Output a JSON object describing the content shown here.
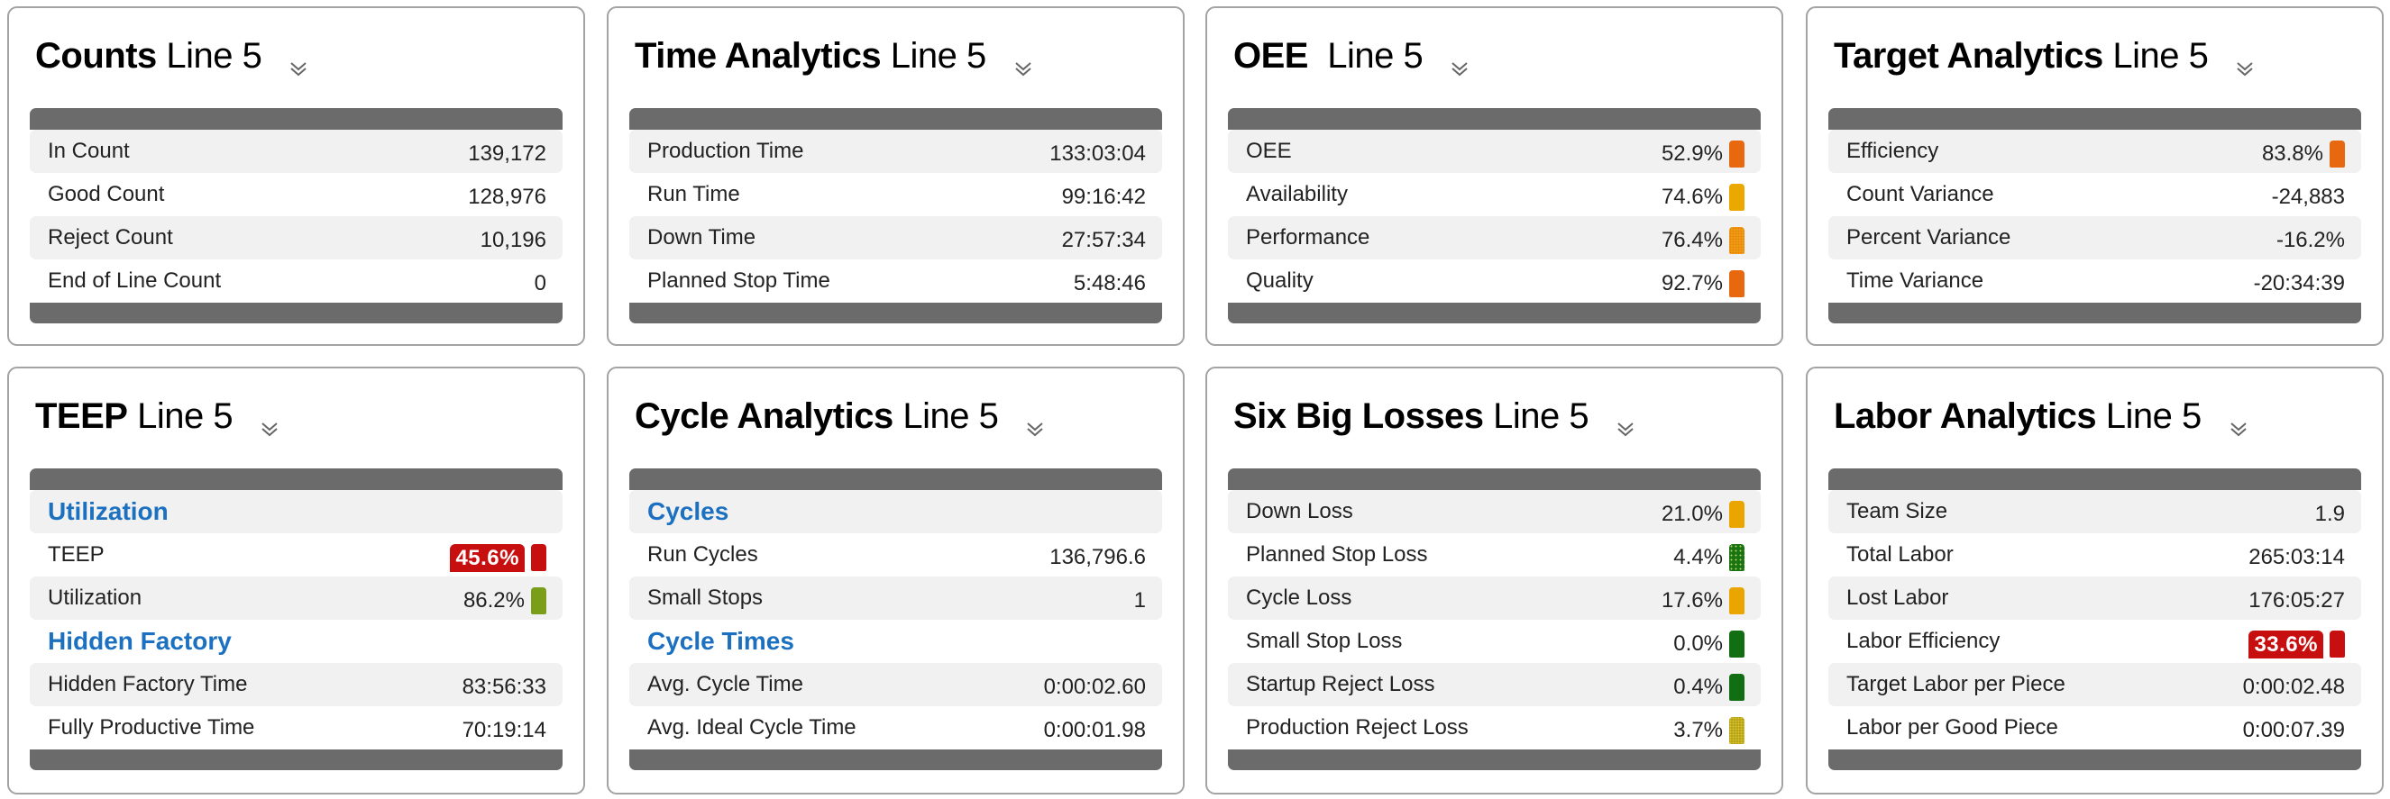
{
  "cards": [
    {
      "title_bold": "Counts",
      "title_suffix": " Line 5",
      "rows": [
        {
          "label": "In Count",
          "value": "139,172"
        },
        {
          "label": "Good Count",
          "value": "128,976"
        },
        {
          "label": "Reject Count",
          "value": "10,196"
        },
        {
          "label": "End of Line Count",
          "value": "0"
        }
      ]
    },
    {
      "title_bold": "Time Analytics",
      "title_suffix": " Line 5",
      "rows": [
        {
          "label": "Production Time",
          "value": "133:03:04"
        },
        {
          "label": "Run Time",
          "value": "99:16:42"
        },
        {
          "label": "Down Time",
          "value": "27:57:34"
        },
        {
          "label": "Planned Stop Time",
          "value": "5:48:46"
        }
      ]
    },
    {
      "title_bold": "OEE",
      "title_suffix": "  Line 5",
      "rows": [
        {
          "label": "OEE",
          "value": "52.9%",
          "indicator": "#e8680f"
        },
        {
          "label": "Availability",
          "value": "74.6%",
          "indicator": "#eaa800"
        },
        {
          "label": "Performance",
          "value": "76.4%",
          "indicator": "#f0a010",
          "pattern": "dither"
        },
        {
          "label": "Quality",
          "value": "92.7%",
          "indicator": "#e8680f"
        }
      ]
    },
    {
      "title_bold": "Target Analytics",
      "title_suffix": " Line 5",
      "rows": [
        {
          "label": "Efficiency",
          "value": "83.8%",
          "indicator": "#e8680f"
        },
        {
          "label": "Count Variance",
          "value": "-24,883"
        },
        {
          "label": "Percent Variance",
          "value": "-16.2%"
        },
        {
          "label": "Time Variance",
          "value": "-20:34:39"
        }
      ]
    },
    {
      "title_bold": "TEEP",
      "title_suffix": " Line 5",
      "rows": [
        {
          "section": "Utilization"
        },
        {
          "label": "TEEP",
          "value": "45.6%",
          "badge": "#c80f0f",
          "indicator": "#c80f0f"
        },
        {
          "label": "Utilization",
          "value": "86.2%",
          "indicator": "#7a9e1a"
        },
        {
          "section": "Hidden Factory"
        },
        {
          "label": "Hidden Factory Time",
          "value": "83:56:33"
        },
        {
          "label": "Fully Productive Time",
          "value": "70:19:14"
        }
      ]
    },
    {
      "title_bold": "Cycle Analytics",
      "title_suffix": " Line 5",
      "rows": [
        {
          "section": "Cycles"
        },
        {
          "label": "Run Cycles",
          "value": "136,796.6"
        },
        {
          "label": "Small Stops",
          "value": "1"
        },
        {
          "section": "Cycle Times"
        },
        {
          "label": "Avg. Cycle Time",
          "value": "0:00:02.60"
        },
        {
          "label": "Avg. Ideal Cycle Time",
          "value": "0:00:01.98"
        }
      ]
    },
    {
      "title_bold": "Six Big Losses",
      "title_suffix": " Line 5",
      "rows": [
        {
          "label": "Down Loss",
          "value": "21.0%",
          "indicator": "#eaa500"
        },
        {
          "label": "Planned Stop Loss",
          "value": "4.4%",
          "indicator": "#1a7412",
          "pattern": "dots"
        },
        {
          "label": "Cycle Loss",
          "value": "17.6%",
          "indicator": "#eaa500"
        },
        {
          "label": "Small Stop Loss",
          "value": "0.0%",
          "indicator": "#126e12"
        },
        {
          "label": "Startup Reject Loss",
          "value": "0.4%",
          "indicator": "#126e12"
        },
        {
          "label": "Production Reject Loss",
          "value": "3.7%",
          "indicator": "#b8a418",
          "pattern": "hatch"
        }
      ]
    },
    {
      "title_bold": "Labor Analytics",
      "title_suffix": " Line 5",
      "rows": [
        {
          "label": "Team Size",
          "value": "1.9"
        },
        {
          "label": "Total Labor",
          "value": "265:03:14"
        },
        {
          "label": "Lost Labor",
          "value": "176:05:27"
        },
        {
          "label": "Labor Efficiency",
          "value": "33.6%",
          "badge": "#c80f0f",
          "indicator": "#c80f0f"
        },
        {
          "label": "Target Labor per Piece",
          "value": "0:00:02.48"
        },
        {
          "label": "Labor per Good Piece",
          "value": "0:00:07.39"
        }
      ]
    }
  ],
  "icons": {
    "expand": "chevron-double-down-icon"
  }
}
